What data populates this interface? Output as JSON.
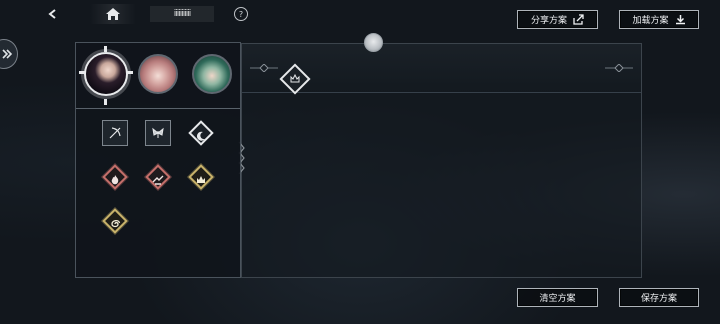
{
  "topbar": {
    "back_icon": "back-arrow-icon",
    "home_icon": "home-icon",
    "title": "iiiiiiiiiii",
    "help_label": "?"
  },
  "buttons": {
    "share": {
      "label": "分享方案",
      "icon": "share-icon"
    },
    "load": {
      "label": "加载方案",
      "icon": "download-icon"
    },
    "clear": {
      "label": "清空方案"
    },
    "save": {
      "label": "保存方案"
    }
  },
  "characters": [
    {
      "name": "character-1",
      "selected": true
    },
    {
      "name": "character-2",
      "selected": false
    },
    {
      "name": "character-3",
      "selected": false
    }
  ],
  "skills": [
    {
      "name": "skill-bow-icon",
      "style": "square-white"
    },
    {
      "name": "skill-wing-icon",
      "style": "square-white"
    },
    {
      "name": "skill-moon-icon",
      "style": "diamond-white"
    },
    {
      "name": "skill-flame-icon",
      "style": "diamond-red"
    },
    {
      "name": "skill-slash-icon",
      "style": "diamond-red"
    },
    {
      "name": "skill-crown-icon",
      "style": "diamond-gold"
    },
    {
      "name": "skill-spiral-icon",
      "style": "diamond-gold"
    }
  ],
  "timeline": {
    "placed_skill": "skill-crown-diamond-icon"
  },
  "colors": {
    "accent_white": "#e6e8ea",
    "red": "#c46f6a",
    "gold": "#c8b26a",
    "panel_border": "#3c444c"
  }
}
